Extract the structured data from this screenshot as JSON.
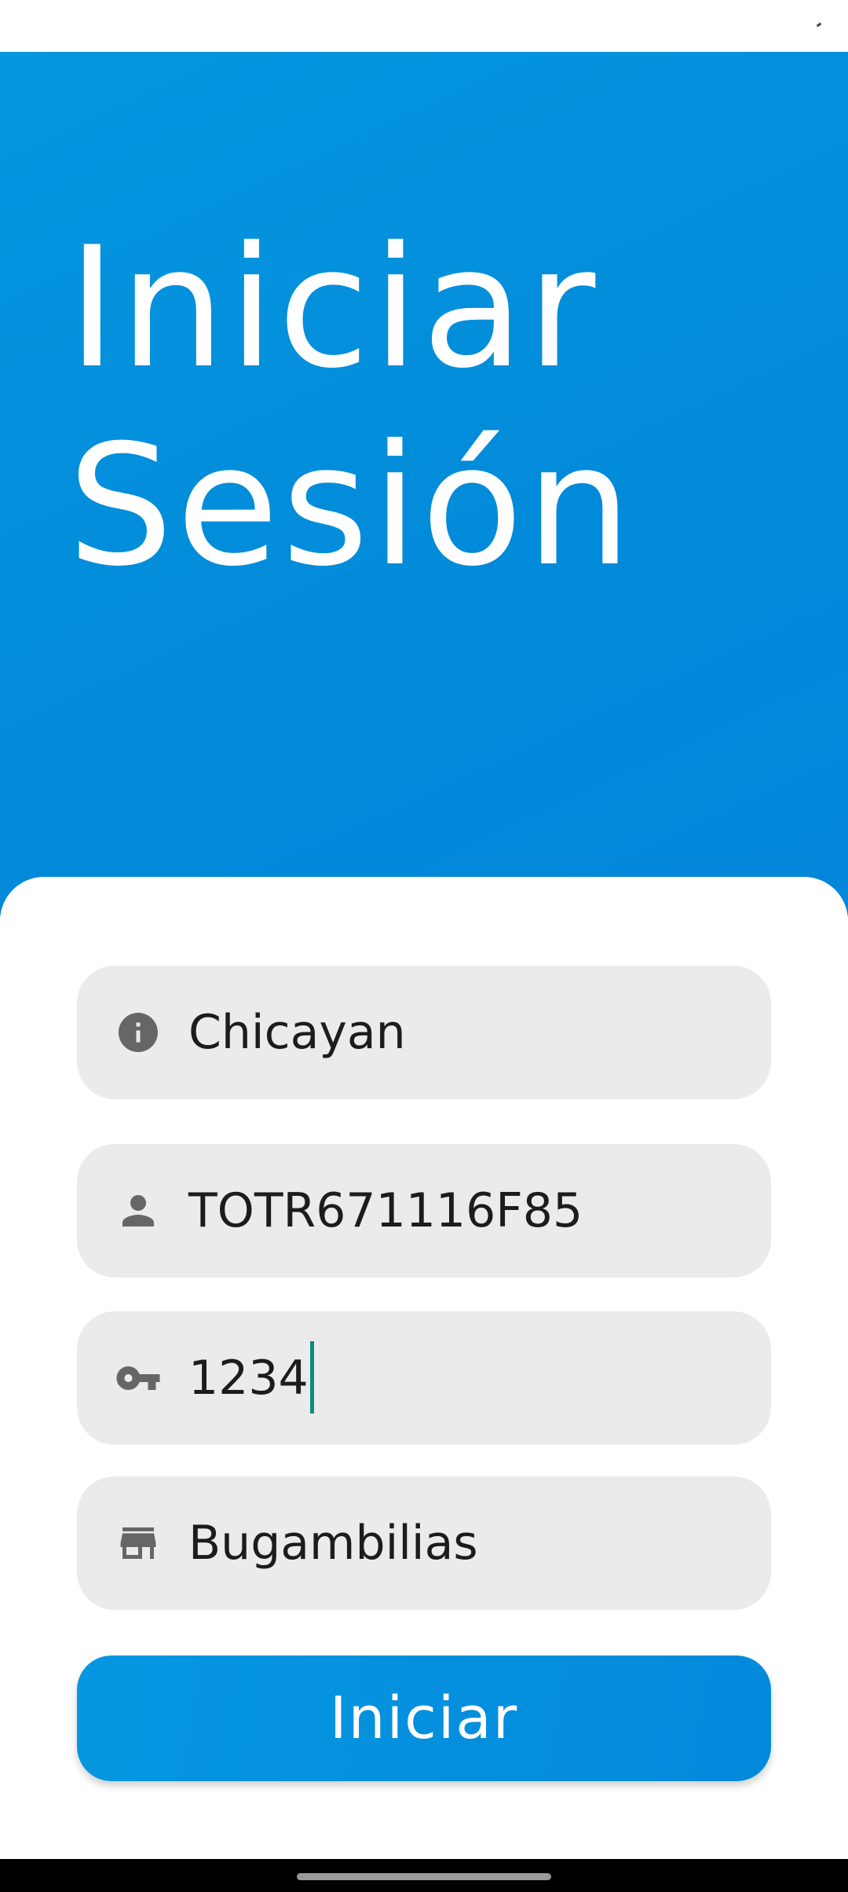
{
  "header": {
    "title_line1": "Iniciar",
    "title_line2": "Sesión"
  },
  "form": {
    "fields": [
      {
        "icon": "info-icon",
        "value": "Chicayan"
      },
      {
        "icon": "person-icon",
        "value": "TOTR671116F85"
      },
      {
        "icon": "key-icon",
        "value": "1234"
      },
      {
        "icon": "store-icon",
        "value": "Bugambilias"
      }
    ],
    "submit_label": "Iniciar"
  },
  "colors": {
    "primary": "#0391dd",
    "field_background": "#ebebeb",
    "caret": "#0e8a7c",
    "icon": "#666666"
  }
}
